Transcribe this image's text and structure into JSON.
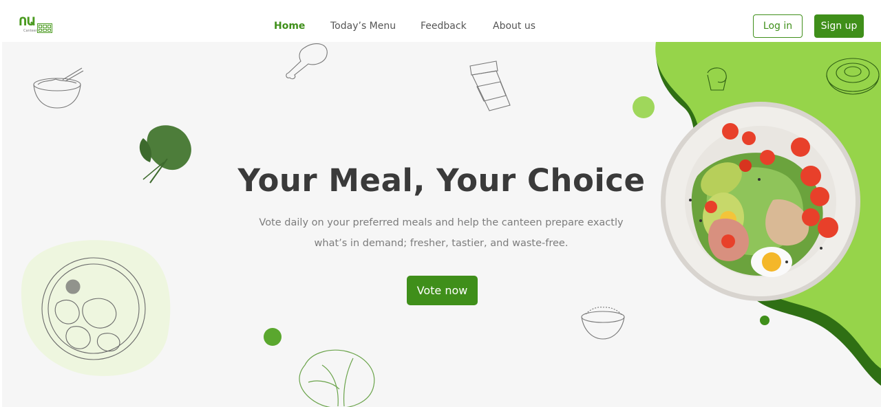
{
  "brand": {
    "logo_text": "ՈԱ",
    "logo_sub": "Canteen"
  },
  "nav": {
    "links": [
      {
        "label": "Home",
        "active": true
      },
      {
        "label": "Today’s Menu",
        "active": false
      },
      {
        "label": "Feedback",
        "active": false
      },
      {
        "label": "About us",
        "active": false
      }
    ],
    "login_label": "Log in",
    "signup_label": "Sign up"
  },
  "hero": {
    "title": "Your Meal, Your Choice",
    "description": "Vote daily on your preferred meals and help the canteen prepare exactly what’s in demand; fresher, tastier, and waste-free.",
    "cta_label": "Vote now"
  },
  "colors": {
    "accent": "#3f8f1a",
    "accent_light": "#96d44a",
    "accent_dark": "#2f6f14",
    "hero_bg": "#f6f6f6",
    "blob_light": "#eef6df"
  },
  "icons": [
    "noodle-bowl-icon",
    "chicken-leg-icon",
    "coffee-cup-icon",
    "spinach-icon",
    "salad-plate-icon",
    "rice-bowl-icon",
    "cabbage-icon",
    "muffin-icon",
    "cinnamon-roll-icon",
    "food-platter-sketch-icon"
  ]
}
